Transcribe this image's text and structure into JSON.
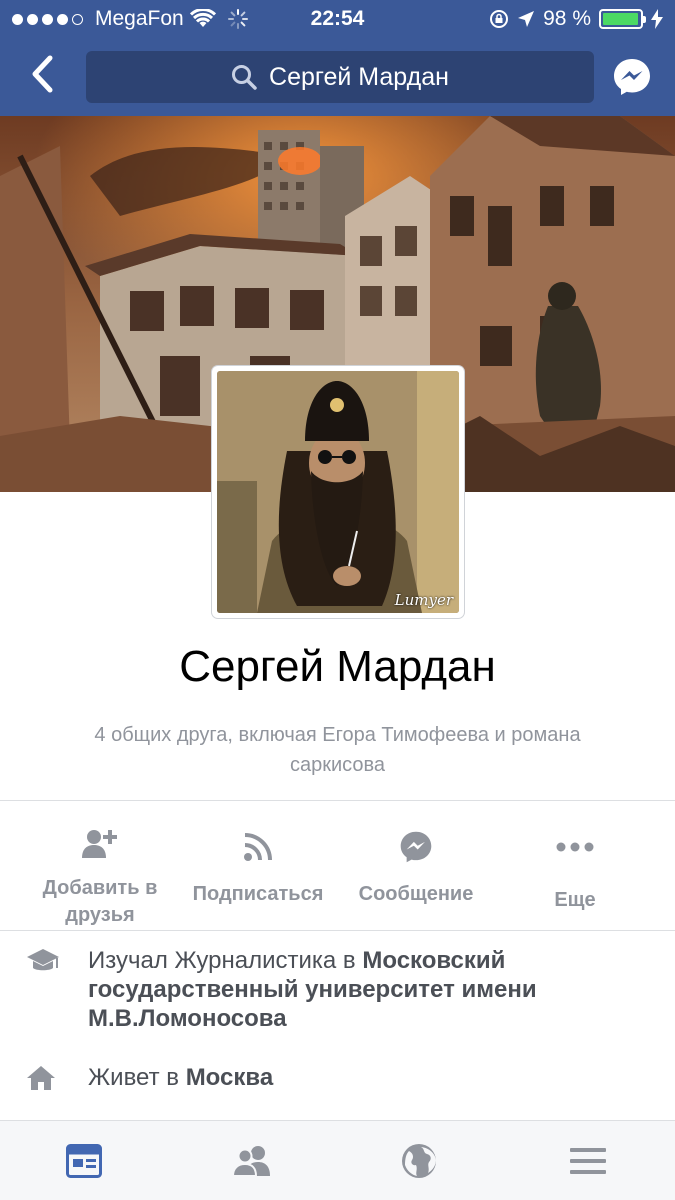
{
  "status_bar": {
    "carrier": "MegaFon",
    "time": "22:54",
    "battery": "98 %"
  },
  "header": {
    "search_text": "Сергей Мардан"
  },
  "profile": {
    "name": "Сергей Мардан",
    "mutual_friends": "4 общих друга, включая Егора Тимофеева и романа саркисова",
    "avatar_watermark": "Lumyer"
  },
  "actions": [
    {
      "label": "Добавить в друзья",
      "icon": "add-friend-icon"
    },
    {
      "label": "Подписаться",
      "icon": "rss-icon"
    },
    {
      "label": "Сообщение",
      "icon": "messenger-icon"
    },
    {
      "label": "Еще",
      "icon": "more-icon"
    }
  ],
  "info": {
    "education": {
      "prefix": "Изучал Журналистика в ",
      "place": "Московский государственный университет имени М.В.Ломоносова",
      "icon": "graduation-cap-icon"
    },
    "lives": {
      "prefix": "Живет в ",
      "place": "Москва",
      "icon": "home-icon"
    }
  },
  "tabbar": [
    "news-feed-icon",
    "friends-icon",
    "globe-icon",
    "menu-icon"
  ],
  "colors": {
    "brand": "#3b5998",
    "search_bg": "#2d4373",
    "icon_gray": "#90949c",
    "active_tab": "#4267b2",
    "battery": "#4cd964"
  }
}
